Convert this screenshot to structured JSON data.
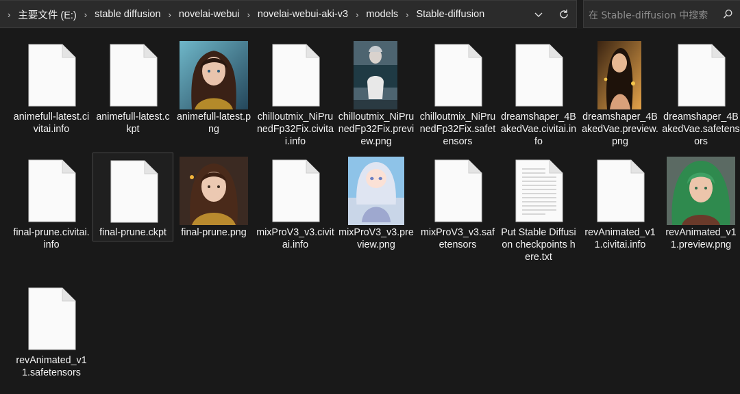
{
  "address_bar": {
    "crumbs": [
      "主要文件 (E:)",
      "stable diffusion",
      "novelai-webui",
      "novelai-webui-aki-v3",
      "models",
      "Stable-diffusion"
    ]
  },
  "search": {
    "placeholder": "在 Stable-diffusion 中搜索"
  },
  "files": [
    {
      "name": "animefull-latest.civitai.info",
      "type": "file"
    },
    {
      "name": "animefull-latest.ckpt",
      "type": "file"
    },
    {
      "name": "animefull-latest.png",
      "type": "image"
    },
    {
      "name": "chilloutmix_NiPrunedFp32Fix.civitai.info",
      "type": "file"
    },
    {
      "name": "chilloutmix_NiPrunedFp32Fix.preview.png",
      "type": "image"
    },
    {
      "name": "chilloutmix_NiPrunedFp32Fix.safetensors",
      "type": "file"
    },
    {
      "name": "dreamshaper_4BakedVae.civitai.info",
      "type": "file"
    },
    {
      "name": "dreamshaper_4BakedVae.preview.png",
      "type": "image"
    },
    {
      "name": "dreamshaper_4BakedVae.safetensors",
      "type": "file"
    },
    {
      "name": "final-prune.civitai.info",
      "type": "file"
    },
    {
      "name": "final-prune.ckpt",
      "type": "file"
    },
    {
      "name": "final-prune.png",
      "type": "image"
    },
    {
      "name": "mixProV3_v3.civitai.info",
      "type": "file"
    },
    {
      "name": "mixProV3_v3.preview.png",
      "type": "image"
    },
    {
      "name": "mixProV3_v3.safetensors",
      "type": "file"
    },
    {
      "name": "Put Stable Diffusion checkpoints here.txt",
      "type": "text"
    },
    {
      "name": "revAnimated_v11.civitai.info",
      "type": "file"
    },
    {
      "name": "revAnimated_v11.preview.png",
      "type": "image"
    },
    {
      "name": "revAnimated_v11.safetensors",
      "type": "file"
    }
  ],
  "selected_file": "final-prune.ckpt",
  "icons": {
    "generic_file": "blank-document-icon",
    "text_file": "text-document-icon",
    "dropdown": "chevron-down-icon",
    "refresh": "refresh-icon",
    "search": "search-icon"
  },
  "colors": {
    "background": "#191919",
    "bar": "#2b2b2b",
    "text": "#f2f2f2",
    "placeholder": "#8c8c8c"
  }
}
